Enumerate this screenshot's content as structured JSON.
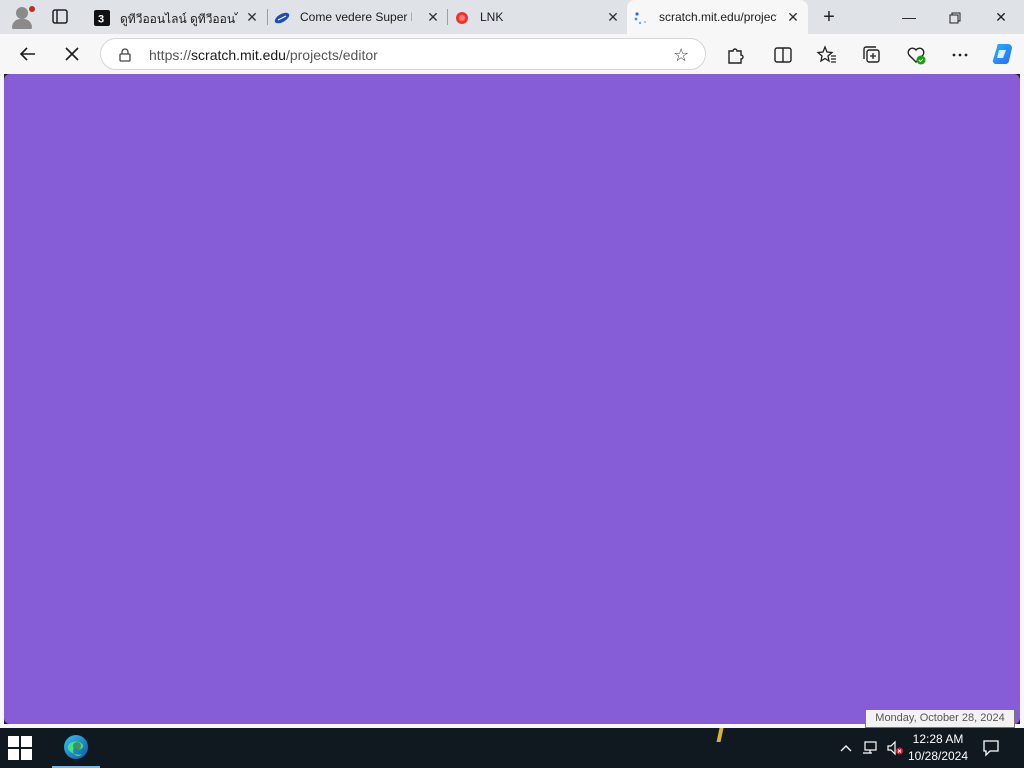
{
  "browser": {
    "tabs": [
      {
        "title": "ดูทีวีออนไลน์ ดูทีวีออนไลน์ฟรี",
        "icon": "channel3-icon",
        "active": false
      },
      {
        "title": "Come vedere Super Bowl",
        "icon": "football-icon",
        "active": false
      },
      {
        "title": "LNK",
        "icon": "red-dot-icon",
        "active": false
      },
      {
        "title": "scratch.mit.edu/projects/editor",
        "icon": "loading-spinner-icon",
        "active": true
      }
    ],
    "url": {
      "scheme": "https://",
      "host": "scratch.mit.edu",
      "path": "/projects/editor"
    }
  },
  "page": {
    "background": "#875cd7"
  },
  "tooltip": {
    "text": "Monday, October 28, 2024"
  },
  "taskbar": {
    "time": "12:28 AM",
    "date": "10/28/2024"
  }
}
